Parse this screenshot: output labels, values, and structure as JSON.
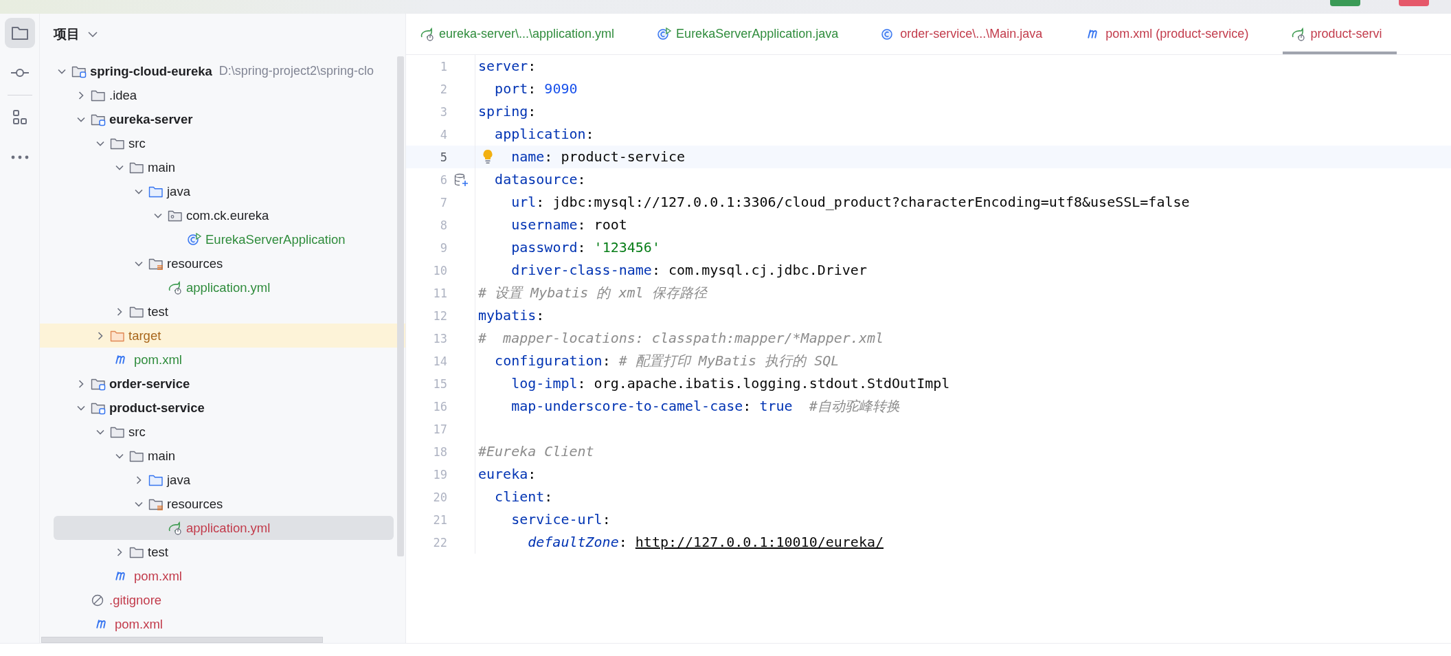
{
  "sidebar": {
    "items": [
      {
        "kind": "project",
        "selected": true
      },
      {
        "kind": "commit",
        "selected": false
      },
      {
        "kind": "structure",
        "selected": false
      },
      {
        "kind": "more",
        "selected": false
      }
    ]
  },
  "project_panel": {
    "title": "项目"
  },
  "project_tree": [
    {
      "label": "spring-cloud-eureka",
      "kind": "module",
      "path": "D:\\spring-project2\\spring-clo",
      "expanded": true,
      "selected": false,
      "children": [
        {
          "label": ".idea",
          "kind": "folder",
          "expanded": false,
          "selected": false
        },
        {
          "label": "eureka-server",
          "kind": "module",
          "expanded": true,
          "selected": false,
          "children": [
            {
              "label": "src",
              "kind": "folder",
              "expanded": true,
              "selected": false,
              "children": [
                {
                  "label": "main",
                  "kind": "folder",
                  "expanded": true,
                  "selected": false,
                  "children": [
                    {
                      "label": "java",
                      "kind": "source-root",
                      "expanded": true,
                      "selected": false,
                      "children": [
                        {
                          "label": "com.ck.eureka",
                          "kind": "package",
                          "expanded": true,
                          "selected": false,
                          "children": [
                            {
                              "label": "EurekaServerApplication",
                              "kind": "java-app",
                              "color": "#2f8c3c",
                              "selected": false
                            }
                          ]
                        }
                      ]
                    },
                    {
                      "label": "resources",
                      "kind": "resources",
                      "expanded": true,
                      "selected": false,
                      "children": [
                        {
                          "label": "application.yml",
                          "kind": "spring",
                          "color": "#2f8c3c",
                          "selected": false
                        }
                      ]
                    }
                  ]
                },
                {
                  "label": "test",
                  "kind": "folder",
                  "expanded": false,
                  "selected": false
                }
              ]
            },
            {
              "label": "target",
              "kind": "excluded",
              "expanded": false,
              "selected": false
            },
            {
              "label": "pom.xml",
              "kind": "maven",
              "color": "#2f8c3c",
              "selected": false
            }
          ]
        },
        {
          "label": "order-service",
          "kind": "module",
          "expanded": false,
          "selected": false
        },
        {
          "label": "product-service",
          "kind": "module",
          "expanded": true,
          "selected": false,
          "children": [
            {
              "label": "src",
              "kind": "folder",
              "expanded": true,
              "selected": false,
              "children": [
                {
                  "label": "main",
                  "kind": "folder",
                  "expanded": true,
                  "selected": false,
                  "children": [
                    {
                      "label": "java",
                      "kind": "source-root",
                      "expanded": false,
                      "selected": false
                    },
                    {
                      "label": "resources",
                      "kind": "resources",
                      "expanded": true,
                      "selected": false,
                      "children": [
                        {
                          "label": "application.yml",
                          "kind": "spring",
                          "color": "#c23b4b",
                          "selected": true
                        }
                      ]
                    }
                  ]
                },
                {
                  "label": "test",
                  "kind": "folder",
                  "expanded": false,
                  "selected": false
                }
              ]
            },
            {
              "label": "pom.xml",
              "kind": "maven",
              "color": "#c23b4b",
              "selected": false
            }
          ]
        },
        {
          "label": ".gitignore",
          "kind": "gitignore",
          "color": "#c23b4b",
          "selected": false
        },
        {
          "label": "pom.xml",
          "kind": "maven",
          "color": "#c23b4b",
          "selected": false
        }
      ]
    }
  ],
  "tabs": [
    {
      "label": "eureka-server\\...\\application.yml",
      "kind": "spring",
      "color": "#2f8c3c",
      "selected": false
    },
    {
      "label": "EurekaServerApplication.java",
      "kind": "java-app",
      "color": "#2f8c3c",
      "selected": false
    },
    {
      "label": "order-service\\...\\Main.java",
      "kind": "java-class",
      "color": "#c23b4b",
      "selected": false
    },
    {
      "label": "pom.xml (product-service)",
      "kind": "maven",
      "color": "#c23b4b",
      "selected": false
    },
    {
      "label": "product-servi",
      "kind": "spring",
      "color": "#c23b4b",
      "selected": true
    }
  ],
  "editor": {
    "lines": [
      {
        "number": "1",
        "current": false,
        "tokens": [
          {
            "kind": "key",
            "text": "server"
          },
          {
            "kind": "punct",
            "text": ":"
          }
        ]
      },
      {
        "number": "2",
        "current": false,
        "tokens": [
          {
            "kind": "key",
            "text": "  port"
          },
          {
            "kind": "punct",
            "text": ": "
          },
          {
            "kind": "number",
            "text": "9090"
          }
        ]
      },
      {
        "number": "3",
        "current": false,
        "tokens": [
          {
            "kind": "key",
            "text": "spring"
          },
          {
            "kind": "punct",
            "text": ":"
          }
        ]
      },
      {
        "number": "4",
        "current": false,
        "tokens": [
          {
            "kind": "key",
            "text": "  application"
          },
          {
            "kind": "punct",
            "text": ":"
          }
        ]
      },
      {
        "number": "5",
        "current": true,
        "bulb": true,
        "tokens": [
          {
            "kind": "key",
            "text": "    name"
          },
          {
            "kind": "punct",
            "text": ": "
          },
          {
            "kind": "text",
            "text": "product-service"
          }
        ]
      },
      {
        "number": "6",
        "current": false,
        "datasource_icon": true,
        "tokens": [
          {
            "kind": "key",
            "text": "  datasource"
          },
          {
            "kind": "punct",
            "text": ":"
          }
        ]
      },
      {
        "number": "7",
        "current": false,
        "tokens": [
          {
            "kind": "key",
            "text": "    url"
          },
          {
            "kind": "punct",
            "text": ": "
          },
          {
            "kind": "text",
            "text": "jdbc:mysql://127.0.0.1:3306/cloud_product?characterEncoding=utf8&useSSL=false"
          }
        ]
      },
      {
        "number": "8",
        "current": false,
        "tokens": [
          {
            "kind": "key",
            "text": "    username"
          },
          {
            "kind": "punct",
            "text": ": "
          },
          {
            "kind": "text",
            "text": "root"
          }
        ]
      },
      {
        "number": "9",
        "current": false,
        "tokens": [
          {
            "kind": "key",
            "text": "    password"
          },
          {
            "kind": "punct",
            "text": ": "
          },
          {
            "kind": "string",
            "text": "'123456'"
          }
        ]
      },
      {
        "number": "10",
        "current": false,
        "tokens": [
          {
            "kind": "key",
            "text": "    driver-class-name"
          },
          {
            "kind": "punct",
            "text": ": "
          },
          {
            "kind": "text",
            "text": "com.mysql.cj.jdbc.Driver"
          }
        ]
      },
      {
        "number": "11",
        "current": false,
        "tokens": [
          {
            "kind": "comment",
            "text": "# 设置 Mybatis 的 xml 保存路径"
          }
        ]
      },
      {
        "number": "12",
        "current": false,
        "tokens": [
          {
            "kind": "key",
            "text": "mybatis"
          },
          {
            "kind": "punct",
            "text": ":"
          }
        ]
      },
      {
        "number": "13",
        "current": false,
        "tokens": [
          {
            "kind": "comment",
            "text": "#  mapper-locations: classpath:mapper/*Mapper.xml"
          }
        ]
      },
      {
        "number": "14",
        "current": false,
        "tokens": [
          {
            "kind": "key",
            "text": "  configuration"
          },
          {
            "kind": "punct",
            "text": ": "
          },
          {
            "kind": "comment",
            "text": "# 配置打印 MyBatis 执行的 SQL"
          }
        ]
      },
      {
        "number": "15",
        "current": false,
        "tokens": [
          {
            "kind": "key",
            "text": "    log-impl"
          },
          {
            "kind": "punct",
            "text": ": "
          },
          {
            "kind": "text",
            "text": "org.apache.ibatis.logging.stdout.StdOutImpl"
          }
        ]
      },
      {
        "number": "16",
        "current": false,
        "tokens": [
          {
            "kind": "key",
            "text": "    map-underscore-to-camel-case"
          },
          {
            "kind": "punct",
            "text": ": "
          },
          {
            "kind": "keyword",
            "text": "true"
          },
          {
            "kind": "comment",
            "text": "  #自动驼峰转换"
          }
        ]
      },
      {
        "number": "17",
        "current": false
      },
      {
        "number": "18",
        "current": false,
        "tokens": [
          {
            "kind": "comment",
            "text": "#Eureka Client"
          }
        ]
      },
      {
        "number": "19",
        "current": false,
        "tokens": [
          {
            "kind": "key",
            "text": "eureka"
          },
          {
            "kind": "punct",
            "text": ":"
          }
        ]
      },
      {
        "number": "20",
        "current": false,
        "tokens": [
          {
            "kind": "key",
            "text": "  client"
          },
          {
            "kind": "punct",
            "text": ":"
          }
        ]
      },
      {
        "number": "21",
        "current": false,
        "tokens": [
          {
            "kind": "key",
            "text": "    service-url"
          },
          {
            "kind": "punct",
            "text": ":"
          }
        ]
      },
      {
        "number": "22",
        "current": false,
        "tokens": [
          {
            "kind": "key-italic",
            "text": "      defaultZone"
          },
          {
            "kind": "punct",
            "text": ": "
          },
          {
            "kind": "url",
            "text": "http://127.0.0.1:10010/eureka/"
          }
        ]
      }
    ]
  }
}
